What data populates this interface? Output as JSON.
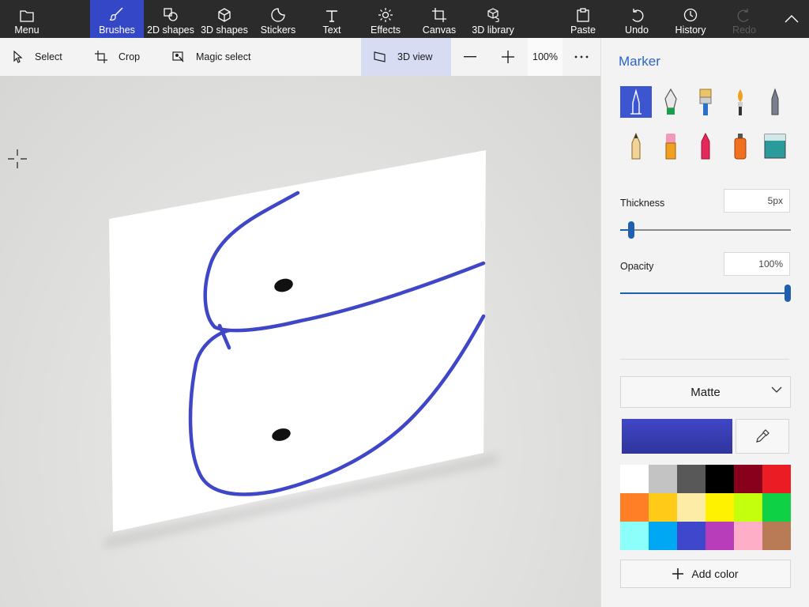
{
  "ribbon": {
    "menu": "Menu",
    "brushes": "Brushes",
    "shapes2d": "2D shapes",
    "shapes3d": "3D shapes",
    "stickers": "Stickers",
    "text": "Text",
    "effects": "Effects",
    "canvas": "Canvas",
    "library3d": "3D library",
    "paste": "Paste",
    "undo": "Undo",
    "history": "History",
    "redo": "Redo",
    "active_tab": "Brushes"
  },
  "commandbar": {
    "select": "Select",
    "crop": "Crop",
    "magic_select": "Magic select",
    "view3d": "3D view",
    "zoom": "100%"
  },
  "panel": {
    "title": "Marker",
    "tools": [
      "marker-icon",
      "calligraphy-pen-icon",
      "oil-brush-icon",
      "watercolor-icon",
      "pixel-pen-icon",
      "pencil-icon",
      "eraser-icon",
      "crayon-icon",
      "spray-can-icon",
      "fill-icon"
    ],
    "selected_tool": "marker-icon",
    "thickness_label": "Thickness",
    "thickness_value": "5px",
    "thickness_level": 0.05,
    "opacity_label": "Opacity",
    "opacity_value": "100%",
    "opacity_level": 1.0,
    "finish": "Matte",
    "current_color": "#4046c8",
    "palette": [
      "#ffffff",
      "#c3c3c3",
      "#585858",
      "#000000",
      "#88001b",
      "#ec1c24",
      "#ff7f27",
      "#ffca18",
      "#fdeca6",
      "#fff200",
      "#c4ff0e",
      "#0ed145",
      "#8cfffb",
      "#00a8f3",
      "#3f48cc",
      "#b83dba",
      "#ffaec8",
      "#b97a56"
    ],
    "add_color": "Add color"
  },
  "colors": {
    "ribbon_bg": "#2b2b2b",
    "accent": "#3447c7",
    "stroke": "#4046c8"
  }
}
